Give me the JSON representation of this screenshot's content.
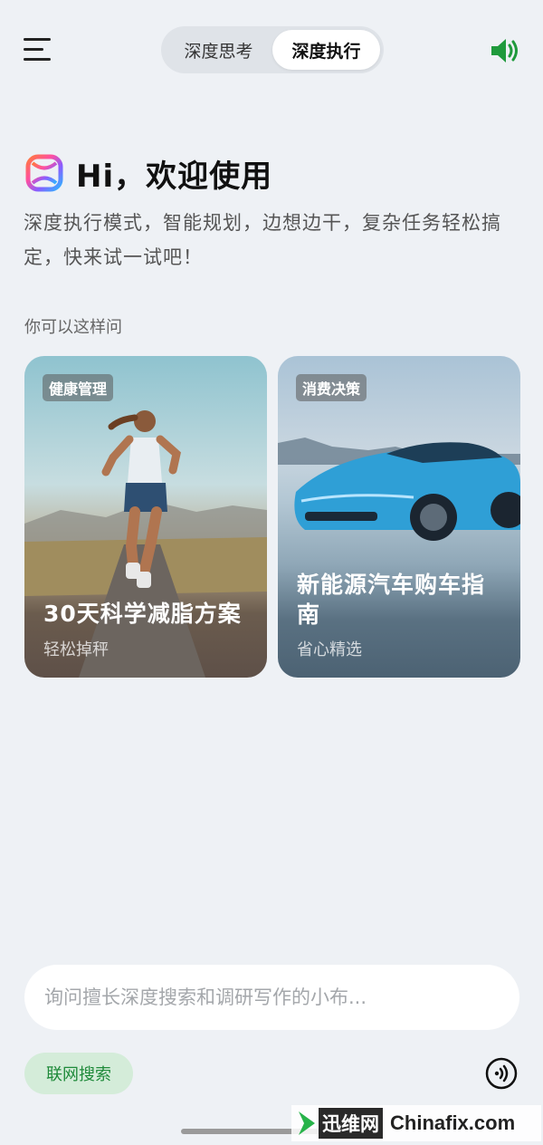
{
  "header": {
    "modes": [
      {
        "label": "深度思考",
        "active": false
      },
      {
        "label": "深度执行",
        "active": true
      }
    ],
    "menu_icon": "hamburger-menu-icon",
    "sound_icon": "speaker-icon"
  },
  "greeting": {
    "title": "Hi，欢迎使用",
    "description": "深度执行模式，智能规划，边想边干，复杂任务轻松搞定，快来试一试吧！"
  },
  "suggestions": {
    "label": "你可以这样问",
    "cards": [
      {
        "tag": "健康管理",
        "title": "30天科学减脂方案",
        "subtitle": "轻松掉秤"
      },
      {
        "tag": "消费决策",
        "title": "新能源汽车购车指南",
        "subtitle": "省心精选"
      }
    ]
  },
  "input": {
    "placeholder": "询问擅长深度搜索和调研写作的小布...",
    "value": ""
  },
  "bottom": {
    "web_search_label": "联网搜索",
    "voice_icon": "voice-wave-icon"
  },
  "watermark": {
    "brand": "迅维网",
    "site": "Chinafix.com"
  },
  "colors": {
    "background": "#eef1f5",
    "accent_green": "#1f8a3a",
    "web_search_bg": "#d4ecd9"
  }
}
